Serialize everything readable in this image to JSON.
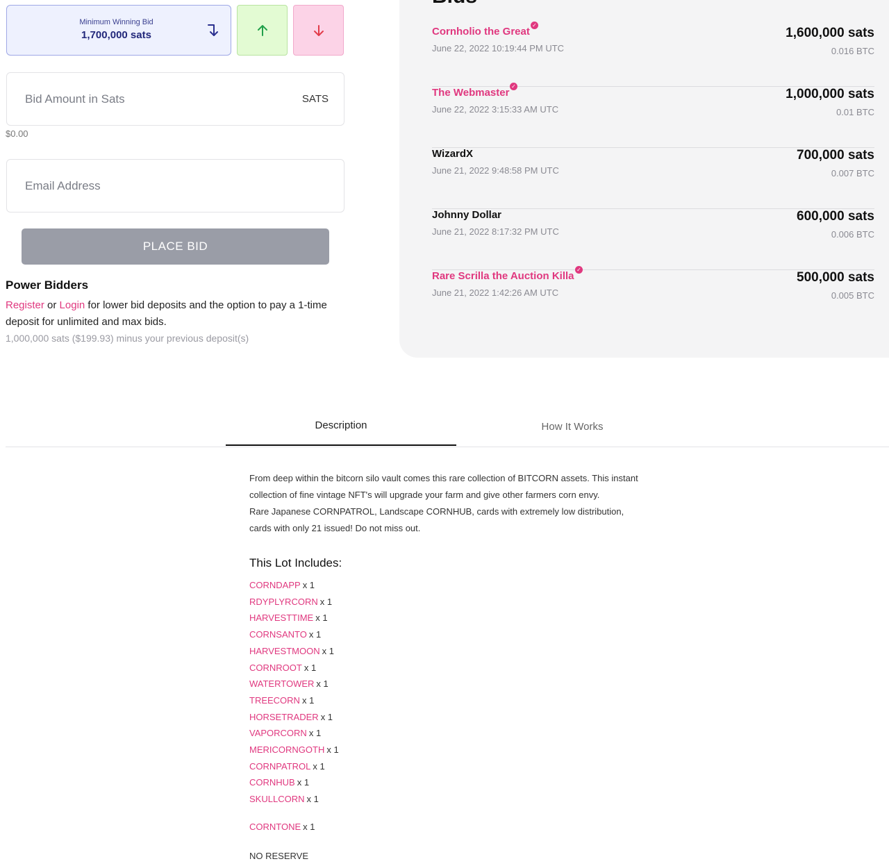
{
  "bid_form": {
    "min_bid_label": "Minimum Winning Bid",
    "min_bid_value": "1,700,000 sats",
    "amount_placeholder": "Bid Amount in Sats",
    "amount_unit": "SATS",
    "usd_value": "$0.00",
    "email_placeholder": "Email Address",
    "place_bid_label": "PLACE BID",
    "icons": {
      "use_min": "arrow-bend-down-icon",
      "increase": "arrow-up-icon",
      "decrease": "arrow-down-icon"
    },
    "colors": {
      "increase": "#22a04b",
      "decrease": "#e23b4a",
      "use_min": "#2a2f8f"
    }
  },
  "power_bidders": {
    "title": "Power Bidders",
    "register_link": "Register",
    "or_text": "or",
    "login_link": "Login",
    "text": "for lower bid deposits and the option to pay a 1-time deposit for unlimited and max bids.",
    "note": "1,000,000 sats ($199.93) minus your previous deposit(s)"
  },
  "bids": {
    "title": "Bids",
    "items": [
      {
        "bidder": "Cornholio the Great",
        "verified": true,
        "time": "June 22, 2022 10:19:44 PM UTC",
        "sats": "1,600,000 sats",
        "btc": "0.016 BTC"
      },
      {
        "bidder": "The Webmaster",
        "verified": true,
        "time": "June 22, 2022 3:15:33 AM UTC",
        "sats": "1,000,000 sats",
        "btc": "0.01 BTC"
      },
      {
        "bidder": "WizardX",
        "verified": false,
        "time": "June 21, 2022 9:48:58 PM UTC",
        "sats": "700,000 sats",
        "btc": "0.007 BTC"
      },
      {
        "bidder": "Johnny Dollar",
        "verified": false,
        "time": "June 21, 2022 8:17:32 PM UTC",
        "sats": "600,000 sats",
        "btc": "0.006 BTC"
      },
      {
        "bidder": "Rare Scrilla the Auction Killa",
        "verified": true,
        "time": "June 21, 2022 1:42:26 AM UTC",
        "sats": "500,000 sats",
        "btc": "0.005 BTC"
      }
    ],
    "badge_icon": "verified-check-icon"
  },
  "tabs": [
    {
      "label": "Description",
      "active": true
    },
    {
      "label": "How It Works",
      "active": false
    }
  ],
  "description": {
    "line1": "From deep within the bitcorn silo vault comes this rare collection of BITCORN assets. This instant",
    "line2": "collection of fine vintage NFT's will upgrade your farm and give other farmers corn envy.",
    "line3": "Rare Japanese CORNPATROL, Landscape CORNHUB, cards with extremely low distribution,",
    "line4": "cards with only 21 issued! Do not miss out."
  },
  "lot": {
    "title": "This Lot Includes:",
    "items": [
      {
        "name": "CORNDAPP",
        "qty": "x 1"
      },
      {
        "name": "RDYPLYRCORN",
        "qty": "x 1"
      },
      {
        "name": "HARVESTTIME",
        "qty": "x 1"
      },
      {
        "name": "CORNSANTO",
        "qty": "x 1"
      },
      {
        "name": "HARVESTMOON",
        "qty": "x 1"
      },
      {
        "name": "CORNROOT",
        "qty": "x 1"
      },
      {
        "name": "WATERTOWER",
        "qty": "x 1"
      },
      {
        "name": "TREECORN",
        "qty": "x 1"
      },
      {
        "name": "HORSETRADER",
        "qty": "x 1"
      },
      {
        "name": "VAPORCORN",
        "qty": "x 1"
      },
      {
        "name": "MERICORNGOTH",
        "qty": "x 1"
      },
      {
        "name": "CORNPATROL",
        "qty": "x 1"
      },
      {
        "name": "CORNHUB",
        "qty": "x 1"
      },
      {
        "name": "SKULLCORN",
        "qty": "x 1"
      },
      {
        "name": "CORNTONE",
        "qty": "x 1"
      }
    ],
    "reserve_text": "NO RESERVE"
  },
  "accent_color": "#e0387f"
}
